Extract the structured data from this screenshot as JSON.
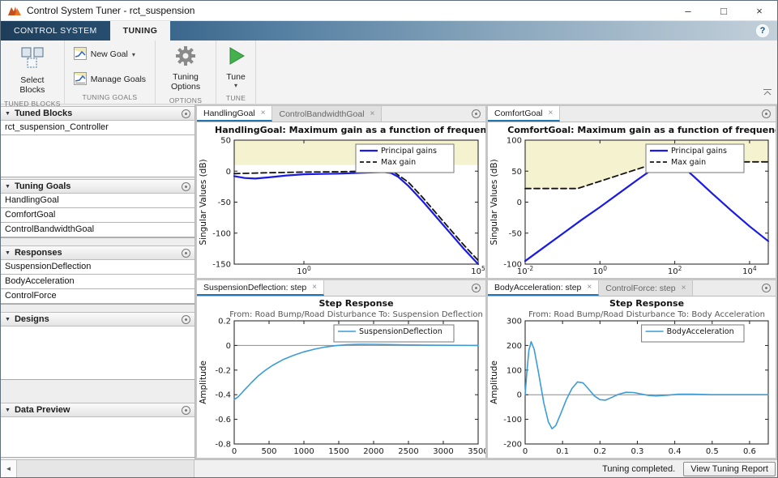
{
  "window": {
    "title": "Control System Tuner - rct_suspension",
    "controls": {
      "minimize": "–",
      "maximize": "□",
      "close": "×"
    }
  },
  "ui": {
    "caret": "▾",
    "panel_arrow": "▼",
    "scroll_glyph": "◄"
  },
  "ribbon": {
    "tabs": [
      {
        "label": "CONTROL SYSTEM"
      },
      {
        "label": "TUNING"
      }
    ],
    "help": "?",
    "toolbar": {
      "select_blocks": "Select Blocks",
      "new_goal": "New Goal",
      "manage_goals": "Manage Goals",
      "tuning_options": "Tuning Options",
      "tune": "Tune",
      "group_labels": {
        "tuned_blocks": "TUNED BLOCKS",
        "tuning_goals": "TUNING GOALS",
        "options": "OPTIONS",
        "tune": "TUNE"
      }
    }
  },
  "sidebar": {
    "panels": [
      {
        "title": "Tuned Blocks",
        "items": [
          "rct_suspension_Controller"
        ]
      },
      {
        "title": "Tuning Goals",
        "items": [
          "HandlingGoal",
          "ComfortGoal",
          "ControlBandwidthGoal"
        ]
      },
      {
        "title": "Responses",
        "items": [
          "SuspensionDeflection",
          "BodyAcceleration",
          "ControlForce"
        ]
      },
      {
        "title": "Designs",
        "items": []
      },
      {
        "title": "Data Preview",
        "items": []
      }
    ]
  },
  "doc_tabs": {
    "close_glyph": "×",
    "top_left": {
      "tabs": [
        {
          "label": "HandlingGoal"
        },
        {
          "label": "ControlBandwidthGoal"
        }
      ]
    },
    "top_right": {
      "tabs": [
        {
          "label": "ComfortGoal"
        }
      ]
    },
    "bottom_left": {
      "tabs": [
        {
          "label": "SuspensionDeflection: step"
        }
      ]
    },
    "bottom_right": {
      "tabs": [
        {
          "label": "BodyAcceleration: step"
        },
        {
          "label": "ControlForce: step"
        }
      ]
    }
  },
  "statusbar": {
    "message": "Tuning completed.",
    "report_button": "View Tuning Report"
  },
  "chart_data": [
    {
      "type": "line",
      "xscale": "log",
      "title": "HandlingGoal: Maximum gain as a function of frequency",
      "ylabel": "Singular Values (dB)",
      "xlim": [
        -2,
        5
      ],
      "ylim": [
        -150,
        50
      ],
      "xticks": [
        {
          "v": 0,
          "label": "10^0"
        },
        {
          "v": 5,
          "label": "10^5"
        }
      ],
      "yticks": [
        {
          "v": 50,
          "label": "50"
        },
        {
          "v": 0,
          "label": "0"
        },
        {
          "v": -50,
          "label": "-50"
        },
        {
          "v": -100,
          "label": "-100"
        },
        {
          "v": -150,
          "label": "-150"
        }
      ],
      "shade": {
        "color": "#f5f2cf",
        "boundary": [
          [
            -2,
            10
          ],
          [
            5,
            10
          ]
        ]
      },
      "legend_position": "top-right",
      "series": [
        {
          "name": "Principal gains",
          "color": "#1a1ae6",
          "width": 2.2,
          "dash": "",
          "points": [
            [
              -2,
              -8
            ],
            [
              -1.7,
              -11
            ],
            [
              -1.4,
              -12
            ],
            [
              -1,
              -10
            ],
            [
              -0.5,
              -7
            ],
            [
              0,
              -5
            ],
            [
              0.5,
              -4.5
            ],
            [
              1,
              -4
            ],
            [
              1.5,
              -3
            ],
            [
              2,
              -2
            ],
            [
              2.3,
              -1.5
            ],
            [
              2.5,
              -3
            ],
            [
              2.7,
              -9
            ],
            [
              3,
              -24
            ],
            [
              3.4,
              -48
            ],
            [
              3.8,
              -74
            ],
            [
              4.2,
              -100
            ],
            [
              4.6,
              -126
            ],
            [
              5,
              -150
            ]
          ]
        },
        {
          "name": "Max gain",
          "color": "#141414",
          "width": 1.8,
          "dash": "7,4",
          "points": [
            [
              -2,
              -4
            ],
            [
              -1,
              -2.5
            ],
            [
              0,
              -1.5
            ],
            [
              1,
              -1
            ],
            [
              2,
              0.5
            ],
            [
              2.4,
              1.5
            ],
            [
              2.6,
              -2
            ],
            [
              3,
              -18
            ],
            [
              3.4,
              -42
            ],
            [
              3.8,
              -68
            ],
            [
              4.2,
              -94
            ],
            [
              4.6,
              -120
            ],
            [
              5,
              -144
            ]
          ]
        }
      ]
    },
    {
      "type": "line",
      "xscale": "log",
      "title": "ComfortGoal: Maximum gain as a function of frequency",
      "ylabel": "Singular Values (dB)",
      "xlim": [
        -2,
        4.5
      ],
      "ylim": [
        -100,
        100
      ],
      "xticks": [
        {
          "v": -2,
          "label": "10^-2"
        },
        {
          "v": 0,
          "label": "10^0"
        },
        {
          "v": 2,
          "label": "10^2"
        },
        {
          "v": 4,
          "label": "10^4"
        }
      ],
      "yticks": [
        {
          "v": 100,
          "label": "100"
        },
        {
          "v": 50,
          "label": "50"
        },
        {
          "v": 0,
          "label": "0"
        },
        {
          "v": -50,
          "label": "-50"
        },
        {
          "v": -100,
          "label": "-100"
        }
      ],
      "shade": {
        "color": "#f5f2cf",
        "boundary": [
          [
            -2,
            22
          ],
          [
            -0.6,
            22
          ],
          [
            1.6,
            65
          ],
          [
            4.5,
            65
          ]
        ]
      },
      "legend_position": "top-right",
      "series": [
        {
          "name": "Principal gains",
          "color": "#1a1ae6",
          "width": 2.2,
          "dash": "",
          "points": [
            [
              -2,
              -95
            ],
            [
              -1.5,
              -73
            ],
            [
              -1,
              -51
            ],
            [
              -0.5,
              -29
            ],
            [
              0,
              -8
            ],
            [
              0.5,
              14
            ],
            [
              1,
              36
            ],
            [
              1.4,
              53
            ],
            [
              1.7,
              63
            ],
            [
              1.9,
              67
            ],
            [
              2.1,
              63
            ],
            [
              2.5,
              42
            ],
            [
              3,
              14
            ],
            [
              3.5,
              -13
            ],
            [
              4,
              -39
            ],
            [
              4.5,
              -63
            ]
          ]
        },
        {
          "name": "Max gain",
          "color": "#141414",
          "width": 1.8,
          "dash": "7,4",
          "points": [
            [
              -2,
              22
            ],
            [
              -0.6,
              22
            ],
            [
              1.6,
              65
            ],
            [
              4.5,
              65
            ]
          ]
        }
      ]
    },
    {
      "type": "line",
      "xscale": "linear",
      "title": "Step Response",
      "subtitle": "From: Road Bump/Road Disturbance  To: Suspension Deflection",
      "ylabel": "Amplitude",
      "xlim": [
        0,
        3500
      ],
      "ylim": [
        -0.8,
        0.2
      ],
      "xticks": [
        {
          "v": 0,
          "label": "0"
        },
        {
          "v": 500,
          "label": "500"
        },
        {
          "v": 1000,
          "label": "1000"
        },
        {
          "v": 1500,
          "label": "1500"
        },
        {
          "v": 2000,
          "label": "2000"
        },
        {
          "v": 2500,
          "label": "2500"
        },
        {
          "v": 3000,
          "label": "3000"
        },
        {
          "v": 3500,
          "label": "3500"
        }
      ],
      "yticks": [
        {
          "v": 0.2,
          "label": "0.2"
        },
        {
          "v": 0,
          "label": "0"
        },
        {
          "v": -0.2,
          "label": "-0.2"
        },
        {
          "v": -0.4,
          "label": "-0.4"
        },
        {
          "v": -0.6,
          "label": "-0.6"
        },
        {
          "v": -0.8,
          "label": "-0.8"
        }
      ],
      "zeroline": true,
      "legend_position": "top-right",
      "series": [
        {
          "name": "SuspensionDeflection",
          "color": "#3c9cd7",
          "width": 1.6,
          "dash": "",
          "points": [
            [
              0,
              -0.44
            ],
            [
              60,
              -0.415
            ],
            [
              150,
              -0.36
            ],
            [
              250,
              -0.3
            ],
            [
              350,
              -0.245
            ],
            [
              450,
              -0.2
            ],
            [
              550,
              -0.162
            ],
            [
              700,
              -0.115
            ],
            [
              850,
              -0.08
            ],
            [
              1000,
              -0.052
            ],
            [
              1150,
              -0.03
            ],
            [
              1300,
              -0.013
            ],
            [
              1450,
              -0.002
            ],
            [
              1600,
              0.005
            ],
            [
              1800,
              0.01
            ],
            [
              2000,
              0.009
            ],
            [
              2200,
              0.007
            ],
            [
              2500,
              0.004
            ],
            [
              2800,
              0.002
            ],
            [
              3100,
              0.001
            ],
            [
              3500,
              0
            ]
          ]
        }
      ]
    },
    {
      "type": "line",
      "xscale": "linear",
      "title": "Step Response",
      "subtitle": "From: Road Bump/Road Disturbance  To: Body Acceleration",
      "ylabel": "Amplitude",
      "xlim": [
        0,
        0.65
      ],
      "ylim": [
        -200,
        300
      ],
      "xticks": [
        {
          "v": 0,
          "label": "0"
        },
        {
          "v": 0.1,
          "label": "0.1"
        },
        {
          "v": 0.2,
          "label": "0.2"
        },
        {
          "v": 0.3,
          "label": "0.3"
        },
        {
          "v": 0.4,
          "label": "0.4"
        },
        {
          "v": 0.5,
          "label": "0.5"
        },
        {
          "v": 0.6,
          "label": "0.6"
        }
      ],
      "yticks": [
        {
          "v": 300,
          "label": "300"
        },
        {
          "v": 200,
          "label": "200"
        },
        {
          "v": 100,
          "label": "100"
        },
        {
          "v": 0,
          "label": "0"
        },
        {
          "v": -100,
          "label": "-100"
        },
        {
          "v": -200,
          "label": "-200"
        }
      ],
      "zeroline": true,
      "legend_position": "top-right",
      "series": [
        {
          "name": "BodyAcceleration",
          "color": "#3c9cd7",
          "width": 1.6,
          "dash": "",
          "points": [
            [
              0,
              0
            ],
            [
              0.004,
              80
            ],
            [
              0.01,
              180
            ],
            [
              0.016,
              215
            ],
            [
              0.024,
              185
            ],
            [
              0.035,
              95
            ],
            [
              0.05,
              -35
            ],
            [
              0.062,
              -110
            ],
            [
              0.072,
              -138
            ],
            [
              0.082,
              -125
            ],
            [
              0.095,
              -78
            ],
            [
              0.11,
              -20
            ],
            [
              0.125,
              25
            ],
            [
              0.14,
              52
            ],
            [
              0.155,
              48
            ],
            [
              0.17,
              22
            ],
            [
              0.185,
              -5
            ],
            [
              0.2,
              -20
            ],
            [
              0.215,
              -22
            ],
            [
              0.23,
              -12
            ],
            [
              0.25,
              2
            ],
            [
              0.27,
              10
            ],
            [
              0.29,
              9
            ],
            [
              0.31,
              3
            ],
            [
              0.33,
              -3
            ],
            [
              0.35,
              -5
            ],
            [
              0.38,
              -2
            ],
            [
              0.41,
              2
            ],
            [
              0.45,
              2
            ],
            [
              0.5,
              0
            ],
            [
              0.58,
              0
            ],
            [
              0.65,
              0
            ]
          ]
        }
      ]
    }
  ]
}
